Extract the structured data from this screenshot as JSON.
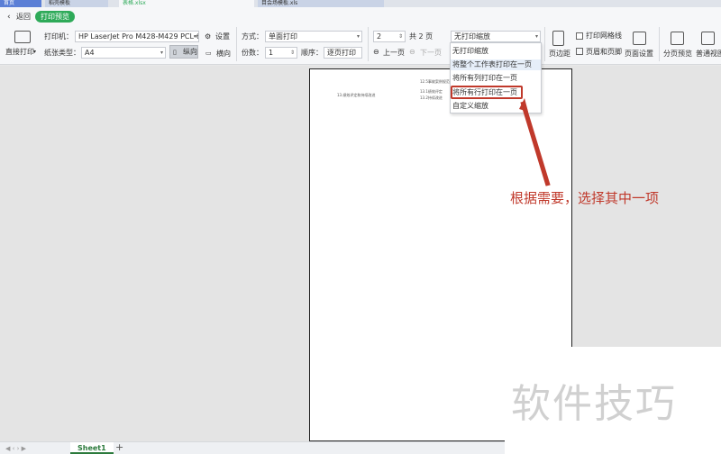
{
  "tabs": [
    {
      "label": "首页"
    },
    {
      "label": "稻壳模板"
    },
    {
      "label": "表格.xlsx"
    },
    {
      "label": "目会场模板.xls"
    }
  ],
  "header": {
    "back_label": "返回",
    "mode_badge": "打印预览"
  },
  "toolbar": {
    "direct_print": "直接打印",
    "printer_label": "打印机：",
    "printer_value": "HP LaserJet Pro M428-M429 PCL-6",
    "settings_label": "设置",
    "paper_label": "纸张类型：",
    "paper_value": "A4",
    "portrait_label": "纵向",
    "landscape_label": "横向",
    "method_label": "方式：",
    "method_value": "单面打印",
    "copies_label": "份数：",
    "copies_value": "1",
    "order_label": "顺序：",
    "order_value": "逐页打印",
    "page_value": "2",
    "total_pages": "共 2 页",
    "prev_page": "上一页",
    "next_page": "下一页",
    "scale_value": "无打印缩放",
    "margins_label": "页边距",
    "gridlines_label": "打印网格线",
    "header_footer_label": "页眉和页脚",
    "page_setup_label": "页面设置",
    "page_break_label": "分页预览",
    "normal_view_label": "普通视图"
  },
  "scale_menu": {
    "items": [
      {
        "label": "无打印缩放"
      },
      {
        "label": "将整个工作表打印在一页"
      },
      {
        "label": "将所有列打印在一页"
      },
      {
        "label": "将所有行打印在一页"
      },
      {
        "label": "自定义缩放"
      }
    ]
  },
  "preview": {
    "line1": "12.5事故案例规范",
    "line2": "13.绩效评定和持续改进",
    "line3": "13.1绩效评定",
    "line4": "13.2持续改进"
  },
  "annotation": "根据需要，选择其中一项",
  "watermark": "软件技巧",
  "sheets": [
    {
      "label": "Sheet1"
    }
  ],
  "add_sheet": "+",
  "colors": {
    "accent_green": "#2eaa59",
    "highlight_red": "#c0392b"
  }
}
